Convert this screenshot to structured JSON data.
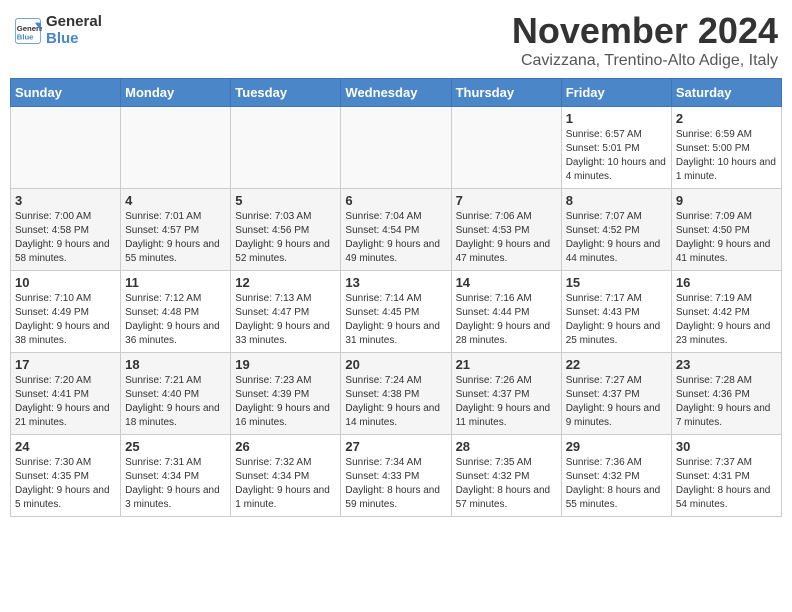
{
  "header": {
    "logo_line1": "General",
    "logo_line2": "Blue",
    "month": "November 2024",
    "location": "Cavizzana, Trentino-Alto Adige, Italy"
  },
  "days_of_week": [
    "Sunday",
    "Monday",
    "Tuesday",
    "Wednesday",
    "Thursday",
    "Friday",
    "Saturday"
  ],
  "weeks": [
    [
      {
        "day": "",
        "info": ""
      },
      {
        "day": "",
        "info": ""
      },
      {
        "day": "",
        "info": ""
      },
      {
        "day": "",
        "info": ""
      },
      {
        "day": "",
        "info": ""
      },
      {
        "day": "1",
        "info": "Sunrise: 6:57 AM\nSunset: 5:01 PM\nDaylight: 10 hours and 4 minutes."
      },
      {
        "day": "2",
        "info": "Sunrise: 6:59 AM\nSunset: 5:00 PM\nDaylight: 10 hours and 1 minute."
      }
    ],
    [
      {
        "day": "3",
        "info": "Sunrise: 7:00 AM\nSunset: 4:58 PM\nDaylight: 9 hours and 58 minutes."
      },
      {
        "day": "4",
        "info": "Sunrise: 7:01 AM\nSunset: 4:57 PM\nDaylight: 9 hours and 55 minutes."
      },
      {
        "day": "5",
        "info": "Sunrise: 7:03 AM\nSunset: 4:56 PM\nDaylight: 9 hours and 52 minutes."
      },
      {
        "day": "6",
        "info": "Sunrise: 7:04 AM\nSunset: 4:54 PM\nDaylight: 9 hours and 49 minutes."
      },
      {
        "day": "7",
        "info": "Sunrise: 7:06 AM\nSunset: 4:53 PM\nDaylight: 9 hours and 47 minutes."
      },
      {
        "day": "8",
        "info": "Sunrise: 7:07 AM\nSunset: 4:52 PM\nDaylight: 9 hours and 44 minutes."
      },
      {
        "day": "9",
        "info": "Sunrise: 7:09 AM\nSunset: 4:50 PM\nDaylight: 9 hours and 41 minutes."
      }
    ],
    [
      {
        "day": "10",
        "info": "Sunrise: 7:10 AM\nSunset: 4:49 PM\nDaylight: 9 hours and 38 minutes."
      },
      {
        "day": "11",
        "info": "Sunrise: 7:12 AM\nSunset: 4:48 PM\nDaylight: 9 hours and 36 minutes."
      },
      {
        "day": "12",
        "info": "Sunrise: 7:13 AM\nSunset: 4:47 PM\nDaylight: 9 hours and 33 minutes."
      },
      {
        "day": "13",
        "info": "Sunrise: 7:14 AM\nSunset: 4:45 PM\nDaylight: 9 hours and 31 minutes."
      },
      {
        "day": "14",
        "info": "Sunrise: 7:16 AM\nSunset: 4:44 PM\nDaylight: 9 hours and 28 minutes."
      },
      {
        "day": "15",
        "info": "Sunrise: 7:17 AM\nSunset: 4:43 PM\nDaylight: 9 hours and 25 minutes."
      },
      {
        "day": "16",
        "info": "Sunrise: 7:19 AM\nSunset: 4:42 PM\nDaylight: 9 hours and 23 minutes."
      }
    ],
    [
      {
        "day": "17",
        "info": "Sunrise: 7:20 AM\nSunset: 4:41 PM\nDaylight: 9 hours and 21 minutes."
      },
      {
        "day": "18",
        "info": "Sunrise: 7:21 AM\nSunset: 4:40 PM\nDaylight: 9 hours and 18 minutes."
      },
      {
        "day": "19",
        "info": "Sunrise: 7:23 AM\nSunset: 4:39 PM\nDaylight: 9 hours and 16 minutes."
      },
      {
        "day": "20",
        "info": "Sunrise: 7:24 AM\nSunset: 4:38 PM\nDaylight: 9 hours and 14 minutes."
      },
      {
        "day": "21",
        "info": "Sunrise: 7:26 AM\nSunset: 4:37 PM\nDaylight: 9 hours and 11 minutes."
      },
      {
        "day": "22",
        "info": "Sunrise: 7:27 AM\nSunset: 4:37 PM\nDaylight: 9 hours and 9 minutes."
      },
      {
        "day": "23",
        "info": "Sunrise: 7:28 AM\nSunset: 4:36 PM\nDaylight: 9 hours and 7 minutes."
      }
    ],
    [
      {
        "day": "24",
        "info": "Sunrise: 7:30 AM\nSunset: 4:35 PM\nDaylight: 9 hours and 5 minutes."
      },
      {
        "day": "25",
        "info": "Sunrise: 7:31 AM\nSunset: 4:34 PM\nDaylight: 9 hours and 3 minutes."
      },
      {
        "day": "26",
        "info": "Sunrise: 7:32 AM\nSunset: 4:34 PM\nDaylight: 9 hours and 1 minute."
      },
      {
        "day": "27",
        "info": "Sunrise: 7:34 AM\nSunset: 4:33 PM\nDaylight: 8 hours and 59 minutes."
      },
      {
        "day": "28",
        "info": "Sunrise: 7:35 AM\nSunset: 4:32 PM\nDaylight: 8 hours and 57 minutes."
      },
      {
        "day": "29",
        "info": "Sunrise: 7:36 AM\nSunset: 4:32 PM\nDaylight: 8 hours and 55 minutes."
      },
      {
        "day": "30",
        "info": "Sunrise: 7:37 AM\nSunset: 4:31 PM\nDaylight: 8 hours and 54 minutes."
      }
    ]
  ]
}
